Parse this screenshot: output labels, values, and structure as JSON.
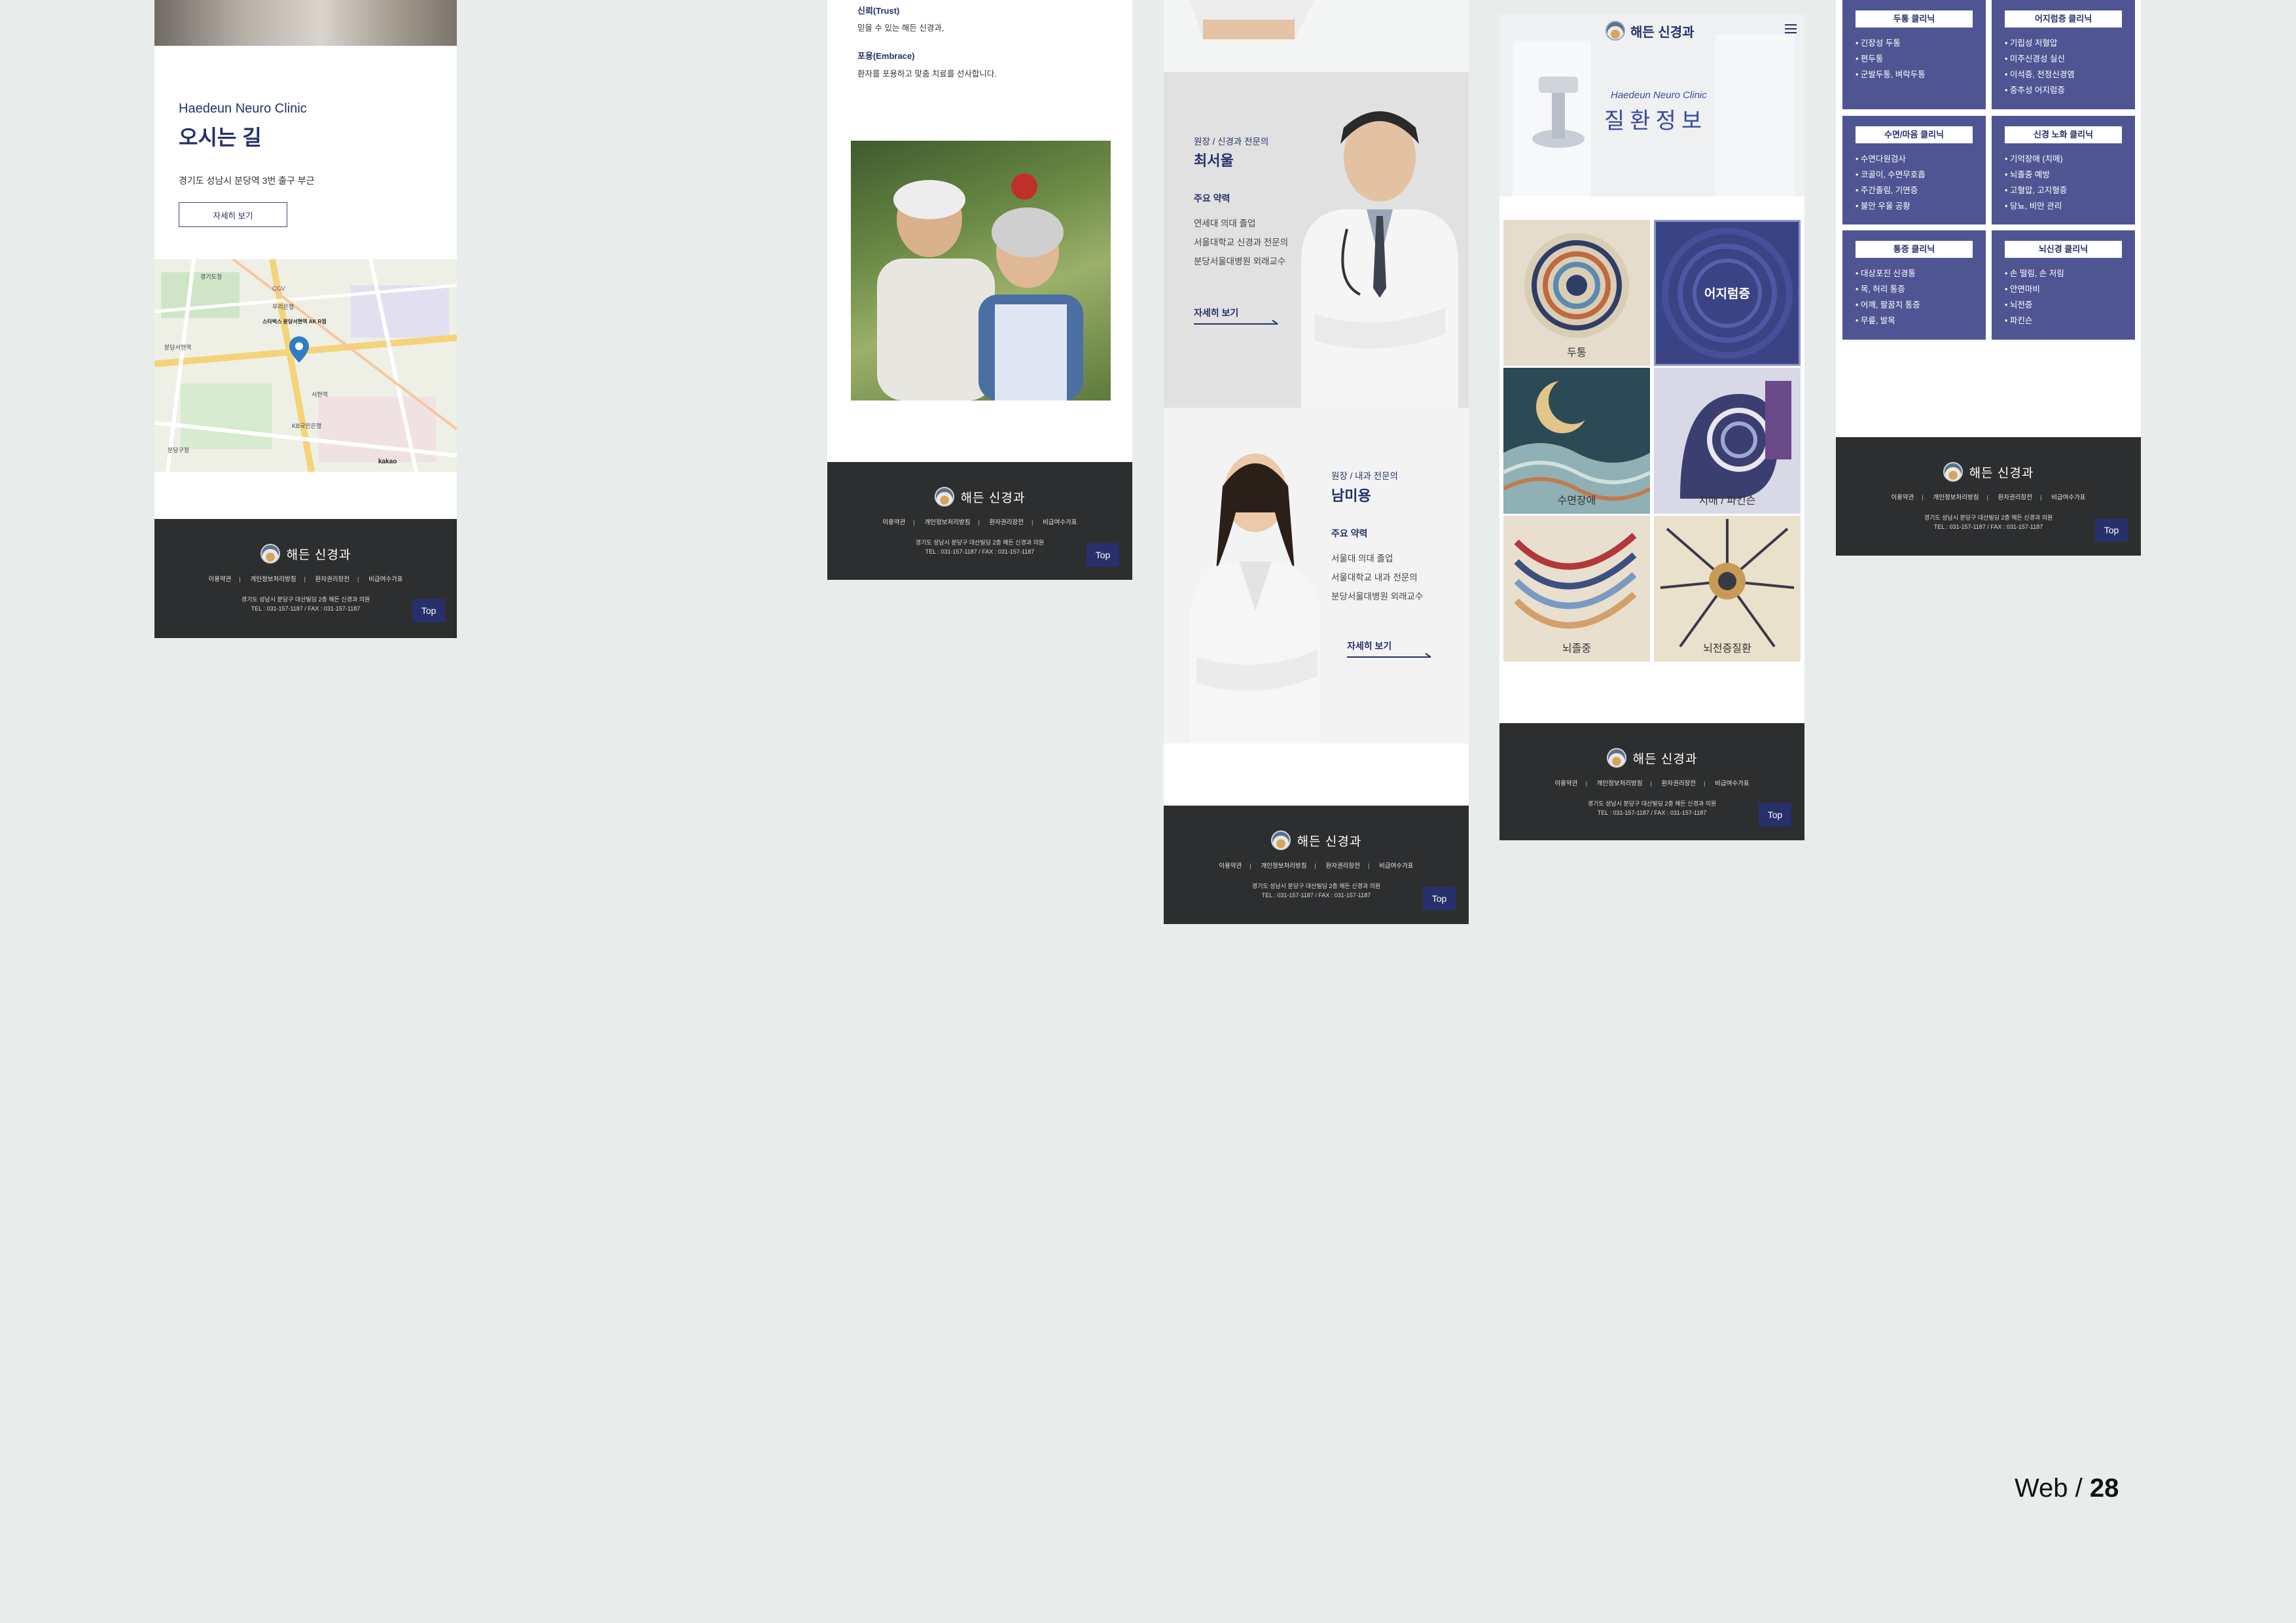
{
  "footer_common": {
    "brand": "해든 신경과",
    "links": [
      "이용약관",
      "개인정보처리방침",
      "환자권리장전",
      "비급여수가표"
    ],
    "address": "경기도 성남시 분당구 대산빌딩 2층 해든 신경과 의원",
    "tel_full": "TEL : 031-157-1187 / FAX : 031-157-1187",
    "top_label": "Top"
  },
  "panel1": {
    "eyebrow": "Haedeun Neuro Clinic",
    "title": "오시는 길",
    "address": "경기도 성남시 분당역 3번 출구 부근",
    "detail_button": "자세히 보기",
    "map_labels": [
      "경기도청",
      "CGV",
      "우리은행",
      "스타벅스 분당서현역 AK R점",
      "분당서현역",
      "분당구청",
      "서현역",
      "KB국민은행",
      "분당구청",
      "kakao"
    ]
  },
  "panel2": {
    "trust_title": "신뢰(Trust)",
    "trust_text": "믿을 수 있는 해든 신경과,",
    "embrace_title": "포용(Embrace)",
    "embrace_text": "환자를 포용하고 맞춤 치료를 선사합니다."
  },
  "panel3": {
    "doctor1": {
      "role": "원장 / 신경과 전문의",
      "name": "최서울",
      "career_title": "주요 약력",
      "career": [
        "연세대 의대 졸업",
        "서울대학교 신경과 전문의",
        "분당서울대병원 외래교수"
      ],
      "more": "자세히 보기"
    },
    "doctor2": {
      "role": "원장 / 내과 전문의",
      "name": "남미용",
      "career_title": "주요 약력",
      "career": [
        "서울대 의대 졸업",
        "서울대학교 내과 전문의",
        "분당서울대병원 외래교수"
      ],
      "more": "자세히 보기"
    }
  },
  "panel4": {
    "brand": "해든 신경과",
    "menu_icon": "hamburger-icon",
    "hero_eyebrow": "Haedeun Neuro Clinic",
    "hero_title": "질환정보",
    "tiles": [
      "두통",
      "어지럼증",
      "수면장애",
      "치매 / 파킨슨",
      "뇌졸중",
      "뇌전증질환"
    ],
    "active_tile": "어지럼증"
  },
  "panel5": {
    "boxes": [
      {
        "title": "두통 클리닉",
        "items": [
          "긴장성 두통",
          "편두통",
          "군발두통, 벼락두통"
        ]
      },
      {
        "title": "어지럼증 클리닉",
        "items": [
          "기립성 저혈압",
          "미주신경성 실신",
          "이석증, 전정신경염",
          "중추성 어지럼증"
        ]
      },
      {
        "title": "수면/마음 클리닉",
        "items": [
          "수면다원검사",
          "코골이, 수면무호흡",
          "주간졸림, 기면증",
          "불안 우울 공황"
        ]
      },
      {
        "title": "신경 노화 클리닉",
        "items": [
          "기억장애 (치매)",
          "뇌졸중 예방",
          "고혈압, 고지혈증",
          "당뇨, 비만 관리"
        ]
      },
      {
        "title": "통증 클리닉",
        "items": [
          "대상포진 신경통",
          "목, 허리 통증",
          "어깨, 팔꿈치 통증",
          "무릎, 발목"
        ]
      },
      {
        "title": "뇌신경 클리닉",
        "items": [
          "손 떨림, 손 저림",
          "안면마비",
          "뇌전증",
          "파킨슨"
        ]
      }
    ]
  },
  "page_label": {
    "prefix": "Web / ",
    "number": "28"
  },
  "colors": {
    "navy": "#25306a",
    "clinic_box": "#4f5593",
    "footer": "#2d2e2f",
    "background": "#e8edec"
  }
}
